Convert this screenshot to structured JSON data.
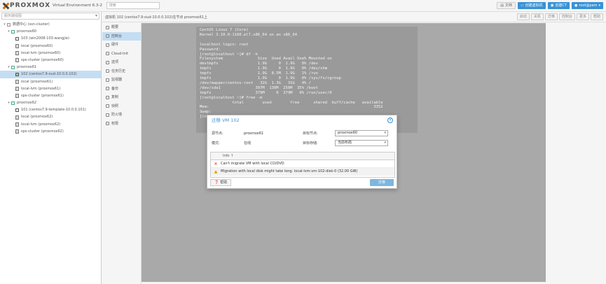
{
  "topbar": {
    "logo_text": "PROXMOX",
    "subtitle": "Virtual Environment 6.3-2",
    "search_placeholder": "搜索",
    "docs_label": "文档",
    "create_vm_label": "创建虚拟机",
    "create_ct_label": "创建CT",
    "user_label": "root@pam"
  },
  "tree": {
    "view_label": "服务器视图",
    "items": [
      {
        "label": "数据中心 (ssn-cluster)",
        "type": "dc",
        "indent": 0
      },
      {
        "label": "proxmox60",
        "type": "node",
        "indent": 1
      },
      {
        "label": "103 (win2008-103-wangjie)",
        "type": "vm",
        "indent": 2
      },
      {
        "label": "local (proxmox60)",
        "type": "stor",
        "indent": 2
      },
      {
        "label": "local-lvm (proxmox60)",
        "type": "stor",
        "indent": 2
      },
      {
        "label": "sps-cluster (proxmox60)",
        "type": "stor",
        "indent": 2
      },
      {
        "label": "proxmox61",
        "type": "node",
        "indent": 1
      },
      {
        "label": "102 (centos7.9-oud-10.0.0.102)",
        "type": "vm-run",
        "indent": 2,
        "selected": true
      },
      {
        "label": "local (proxmox61)",
        "type": "stor",
        "indent": 2
      },
      {
        "label": "local-lvm (proxmox61)",
        "type": "stor",
        "indent": 2
      },
      {
        "label": "sps-cluster (proxmox61)",
        "type": "stor",
        "indent": 2
      },
      {
        "label": "proxmox62",
        "type": "node",
        "indent": 1
      },
      {
        "label": "101 (centos7.9-template-10.0.0.101)",
        "type": "vm",
        "indent": 2
      },
      {
        "label": "local (proxmox62)",
        "type": "stor",
        "indent": 2
      },
      {
        "label": "local-lvm (proxmox62)",
        "type": "stor",
        "indent": 2
      },
      {
        "label": "sps-cluster (proxmox62)",
        "type": "stor",
        "indent": 2
      }
    ]
  },
  "header": {
    "breadcrumb": "虚拟机 102 (centos7.9-oud-10.0.0.102)在节点 proxmox61上",
    "buttons": [
      "启动",
      "关机",
      "迁移",
      "控制台",
      "更多",
      "帮助"
    ]
  },
  "subnav": [
    "概要",
    "控制台",
    "硬件",
    "Cloud-Init",
    "选项",
    "任务历史",
    "监视器",
    "备份",
    "复制",
    "快照",
    "防火墙",
    "权限"
  ],
  "console": {
    "lines": [
      "CentOS Linux 7 (Core)",
      "Kernel 3.10.0-1160.el7.x86_64 on an x86_64",
      "",
      "localhost login: root",
      "Password:",
      "[root@localhost ~]# df -h",
      "Filesystem               Size  Used Avail Use% Mounted on",
      "devtmpfs                 1.9G     0  1.9G   0% /dev",
      "tmpfs                    1.9G     0  1.9G   0% /dev/shm",
      "tmpfs                    1.9G  8.5M  1.9G   1% /run",
      "tmpfs                    1.9G     0  1.9G   0% /sys/fs/cgroup",
      "/dev/mapper/centos-root   32G  1.3G   31G   4% /",
      "/dev/sda1               397M  130M  250M  35% /boot",
      "tmpfs                   379M     0  379M   0% /run/user/0",
      "[root@localhost ~]# free -m",
      "              total        used        free      shared  buff/cache   available",
      "Mem:                                                                       3352",
      "Swap:",
      "[ro"
    ]
  },
  "dialog": {
    "title": "迁移 VM 102",
    "source_label": "源节点:",
    "source_value": "proxmox61",
    "mode_label": "模式:",
    "mode_value": "在线",
    "target_label": "目标节点:",
    "target_value": "proxmox60",
    "target_storage_label": "目标存储:",
    "target_storage_value": "当前布局",
    "grid_header": "Info ↑",
    "rows": [
      {
        "icon": "error",
        "text": "Can't migrate VM with local CD/DVD"
      },
      {
        "icon": "warning",
        "text": "Migration with local disk might take long: local-lvm:vm-102-disk-0 (32.00 GiB)"
      }
    ],
    "help_label": "帮助",
    "migrate_label": "迁移"
  }
}
